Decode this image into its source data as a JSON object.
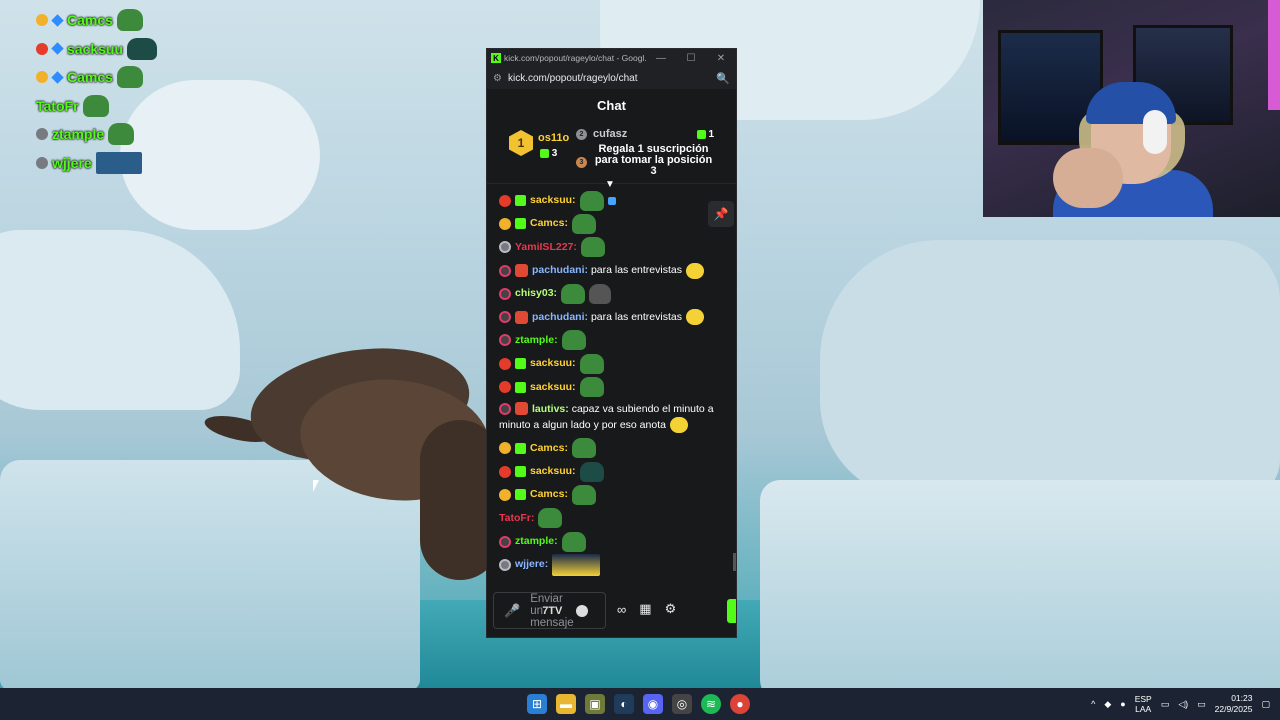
{
  "overlay": {
    "rows": [
      {
        "name": "Camcs",
        "badge": "gold",
        "emote": "pepe"
      },
      {
        "name": "sacksuu",
        "badge": "red",
        "emote": "dark"
      },
      {
        "name": "Camcs",
        "badge": "gold",
        "emote": "pepe"
      },
      {
        "name": "TatoFr",
        "badge": "",
        "emote": "pepe"
      },
      {
        "name": "ztample",
        "badge": "grey",
        "emote": "pepe"
      },
      {
        "name": "wjjere",
        "badge": "grey",
        "emote": "wide"
      }
    ]
  },
  "window": {
    "title": "kick.com/popout/rageylo/chat - Googl...",
    "url": "kick.com/popout/rageylo/chat",
    "minimize": "—",
    "maximize": "☐",
    "close": "✕"
  },
  "chat": {
    "header": "Chat",
    "leaderboard": {
      "first": {
        "rank": "1",
        "name": "os11o",
        "count": "3"
      },
      "second": {
        "rank": "2",
        "name": "cufasz",
        "count": "1"
      },
      "third": {
        "rank": "3",
        "text": "Regala 1 suscripción para tomar la posición 3"
      }
    },
    "messages": [
      {
        "user": "sacksuu",
        "color": "#ffd233",
        "badges": [
          "red",
          "sub"
        ],
        "text": "",
        "emotes": [
          "pepe",
          "blue"
        ]
      },
      {
        "user": "Camcs",
        "color": "#ffd233",
        "badges": [
          "gold",
          "sub"
        ],
        "text": "",
        "emotes": [
          "pepe"
        ]
      },
      {
        "user": "YamiISL227",
        "color": "#e8374e",
        "badges": [
          "grey"
        ],
        "text": "",
        "emotes": [
          "pepe"
        ]
      },
      {
        "user": "pachudani",
        "color": "#89b7ff",
        "badges": [
          "pink",
          "tw"
        ],
        "text": "para las entrevistas",
        "emotes": [
          "yellow"
        ]
      },
      {
        "user": "chisy03",
        "color": "#b5ff7a",
        "badges": [
          "pink"
        ],
        "text": "",
        "emotes": [
          "pepe",
          "tea"
        ]
      },
      {
        "user": "pachudani",
        "color": "#89b7ff",
        "badges": [
          "pink",
          "tw"
        ],
        "text": "para las entrevistas",
        "emotes": [
          "yellow"
        ]
      },
      {
        "user": "ztample",
        "color": "#53fc18",
        "badges": [
          "pink"
        ],
        "text": "",
        "emotes": [
          "pepe"
        ]
      },
      {
        "user": "sacksuu",
        "color": "#ffd233",
        "badges": [
          "red",
          "sub"
        ],
        "text": "",
        "emotes": [
          "pepe"
        ]
      },
      {
        "user": "sacksuu",
        "color": "#ffd233",
        "badges": [
          "red",
          "sub"
        ],
        "text": "",
        "emotes": [
          "pepe"
        ]
      },
      {
        "user": "lautivs",
        "color": "#b5ff7a",
        "badges": [
          "pink",
          "tw"
        ],
        "text": "capaz va subiendo el minuto a minuto a algun lado y por eso anota",
        "emotes": [
          "yellow"
        ]
      },
      {
        "user": "Camcs",
        "color": "#ffd233",
        "badges": [
          "gold",
          "sub"
        ],
        "text": "",
        "emotes": [
          "pepe"
        ]
      },
      {
        "user": "sacksuu",
        "color": "#ffd233",
        "badges": [
          "red",
          "sub"
        ],
        "text": "",
        "emotes": [
          "dark"
        ]
      },
      {
        "user": "Camcs",
        "color": "#ffd233",
        "badges": [
          "gold",
          "sub"
        ],
        "text": "",
        "emotes": [
          "pepe"
        ]
      },
      {
        "user": "TatoFr",
        "color": "#e8374e",
        "badges": [],
        "text": "",
        "emotes": [
          "pepe"
        ]
      },
      {
        "user": "ztample",
        "color": "#53fc18",
        "badges": [
          "pink"
        ],
        "text": "",
        "emotes": [
          "pepe"
        ]
      },
      {
        "user": "wjjere",
        "color": "#89b7ff",
        "badges": [
          "grey"
        ],
        "text": "",
        "emotes": [
          "wide"
        ]
      }
    ],
    "input_placeholder": "Enviar un mensaje",
    "seventv": "7TV"
  },
  "taskbar": {
    "lang_top": "ESP",
    "lang_bottom": "LAA",
    "time": "01:23",
    "date": "22/9/2025"
  },
  "colors": {
    "kick_green": "#53fc18",
    "gold": "#ffd233"
  }
}
